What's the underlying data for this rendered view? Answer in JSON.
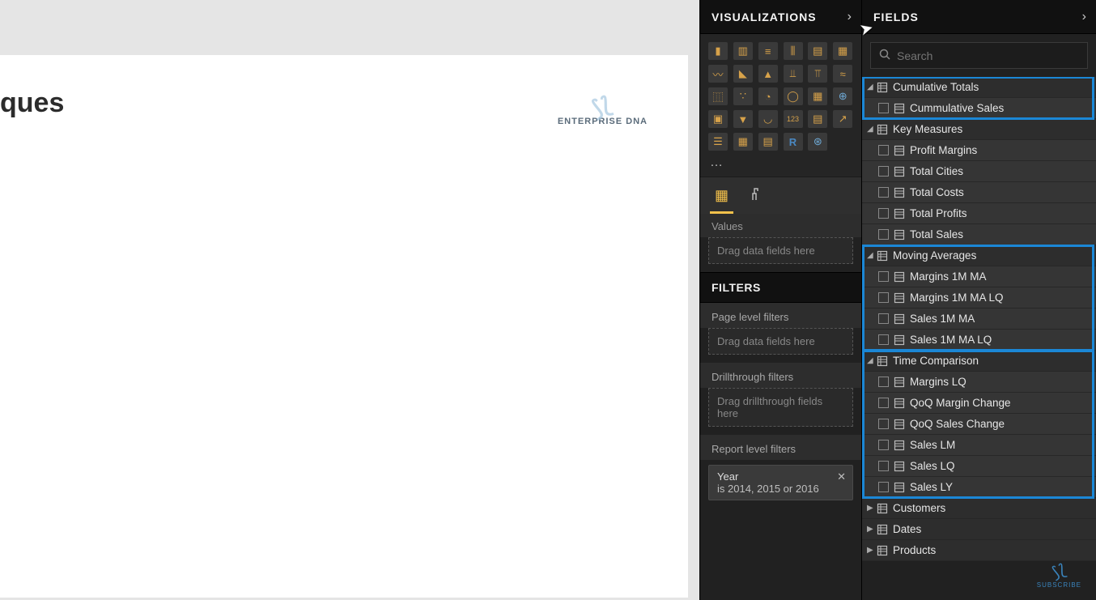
{
  "canvas": {
    "title_fragment": "ques",
    "brand": "ENTERPRISE DNA"
  },
  "viz_panel": {
    "header": "VISUALIZATIONS",
    "values_label": "Values",
    "values_placeholder": "Drag data fields here",
    "filters_header": "FILTERS",
    "page_filters_label": "Page level filters",
    "page_filters_placeholder": "Drag data fields here",
    "drill_label": "Drillthrough filters",
    "drill_placeholder": "Drag drillthrough fields here",
    "report_filters_label": "Report level filters",
    "year_filter_name": "Year",
    "year_filter_desc": "is 2014, 2015 or 2016"
  },
  "fields_panel": {
    "header": "FIELDS",
    "search_placeholder": "Search",
    "tables": [
      {
        "name": "Cumulative Totals",
        "expanded": true,
        "highlight": true,
        "fields": [
          {
            "name": "Cummulative Sales"
          }
        ]
      },
      {
        "name": "Key Measures",
        "expanded": true,
        "highlight": false,
        "fields": [
          {
            "name": "Profit Margins"
          },
          {
            "name": "Total Cities"
          },
          {
            "name": "Total Costs"
          },
          {
            "name": "Total Profits"
          },
          {
            "name": "Total Sales"
          }
        ]
      },
      {
        "name": "Moving Averages",
        "expanded": true,
        "highlight": true,
        "fields": [
          {
            "name": "Margins 1M MA"
          },
          {
            "name": "Margins 1M MA LQ"
          },
          {
            "name": "Sales 1M MA"
          },
          {
            "name": "Sales 1M MA LQ"
          }
        ]
      },
      {
        "name": "Time Comparison",
        "expanded": true,
        "highlight": true,
        "fields": [
          {
            "name": "Margins LQ"
          },
          {
            "name": "QoQ Margin Change"
          },
          {
            "name": "QoQ Sales Change"
          },
          {
            "name": "Sales LM"
          },
          {
            "name": "Sales LQ"
          },
          {
            "name": "Sales LY"
          }
        ]
      },
      {
        "name": "Customers",
        "expanded": false,
        "highlight": false,
        "fields": []
      },
      {
        "name": "Dates",
        "expanded": false,
        "highlight": false,
        "fields": []
      },
      {
        "name": "Products",
        "expanded": false,
        "highlight": false,
        "fields": []
      }
    ]
  },
  "subscribe_label": "SUBSCRIBE"
}
